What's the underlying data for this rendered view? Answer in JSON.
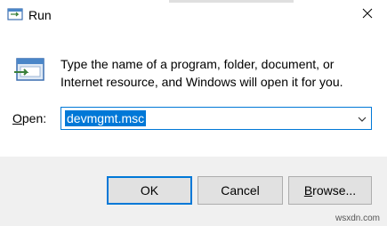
{
  "window": {
    "title": "Run",
    "icons": {
      "title": "run-app-icon",
      "close": "close-icon",
      "large": "run-app-icon"
    }
  },
  "dialog": {
    "description": "Type the name of a program, folder, document, or Internet resource, and Windows will open it for you.",
    "open_label_mnemonic": "O",
    "open_label_rest": "pen:",
    "open_value": "devmgmt.msc",
    "dropdown_icon": "chevron-down-icon"
  },
  "buttons": {
    "ok": "OK",
    "cancel": "Cancel",
    "browse_mnemonic": "B",
    "browse_rest": "rowse..."
  },
  "colors": {
    "accent": "#0078d7",
    "footer_bg": "#f0f0f0",
    "button_bg": "#e1e1e1"
  },
  "watermark": "wsxdn.com"
}
